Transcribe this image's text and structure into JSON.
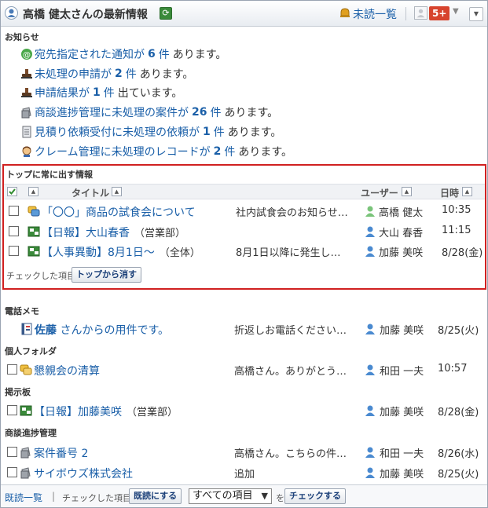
{
  "header": {
    "title": "高橋 健太さんの最新情報",
    "unread_label": "未読一覧",
    "badge": "5+"
  },
  "notices": {
    "section_title": "お知らせ",
    "items": [
      {
        "icon": "at-mention-icon",
        "link": "宛先指定された通知が",
        "count": "6",
        "unit": "件",
        "suffix": "あります。"
      },
      {
        "icon": "stamp-icon",
        "link": "未処理の申請が",
        "count": "2",
        "unit": "件",
        "suffix": "あります。"
      },
      {
        "icon": "stamp-icon",
        "link": "申請結果が",
        "count": "1",
        "unit": "件",
        "suffix": "出ています。"
      },
      {
        "icon": "folder-cabinet-icon",
        "link": "商談進捗管理に未処理の案件が",
        "count": "26",
        "unit": "件",
        "suffix": "あります。"
      },
      {
        "icon": "document-icon",
        "link": "見積り依頼受付に未処理の依頼が",
        "count": "1",
        "unit": "件",
        "suffix": "あります。"
      },
      {
        "icon": "person-icon",
        "link": "クレーム管理に未処理のレコードが",
        "count": "2",
        "unit": "件",
        "suffix": "あります。"
      }
    ]
  },
  "pinned": {
    "section_title": "トップに常に出す情報",
    "columns": {
      "title": "タイトル",
      "user": "ユーザー",
      "datetime": "日時"
    },
    "rows": [
      {
        "title": "「〇〇」商品の試食会について",
        "sub": "",
        "preview": "社内試食会のお知らせ…",
        "user": "高橋 健太",
        "date": "10:35"
      },
      {
        "title": "【日報】大山春香",
        "sub": "（営業部）",
        "preview": "",
        "user": "大山 春香",
        "date": "11:15"
      },
      {
        "title": "【人事異動】8月1日～",
        "sub": "（全体）",
        "preview": "8月1日以降に発生し…",
        "user": "加藤 美咲",
        "date": "8/28(金)"
      }
    ],
    "checked_label": "チェックした項目を",
    "remove_button": "トップから消す"
  },
  "memo": {
    "section_title": "電話メモ",
    "rows": [
      {
        "title_bold": "佐藤",
        "title": "さんからの用件です。",
        "preview": "折返しお電話ください…",
        "user": "加藤 美咲",
        "date": "8/25(火)"
      }
    ]
  },
  "personal": {
    "section_title": "個人フォルダ",
    "rows": [
      {
        "title": "懇親会の清算",
        "preview": "高橋さん。ありがとう…",
        "user": "和田 一夫",
        "date": "10:57"
      }
    ]
  },
  "bulletin": {
    "section_title": "掲示板",
    "rows": [
      {
        "title": "【日報】加藤美咲",
        "sub": "（営業部）",
        "preview": "",
        "user": "加藤 美咲",
        "date": "8/28(金)"
      }
    ]
  },
  "deals": {
    "section_title": "商談進捗管理",
    "rows": [
      {
        "title": "案件番号 2",
        "preview": "高橋さん。こちらの件…",
        "user": "和田 一夫",
        "date": "8/26(水)"
      },
      {
        "title": "サイボウズ株式会社",
        "preview": "追加",
        "user": "加藤 美咲",
        "date": "8/25(火)"
      }
    ]
  },
  "footer": {
    "read_list": "既読一覧",
    "divider": "|",
    "checked_label": "チェックした項目を",
    "mark_read_button": "既読にする",
    "filter_value": "すべての項目",
    "wo": "を",
    "check_button": "チェックする"
  },
  "colors": {
    "link": "#1a5fa8",
    "badge": "#d7432d",
    "highlight_border": "#d02020"
  }
}
